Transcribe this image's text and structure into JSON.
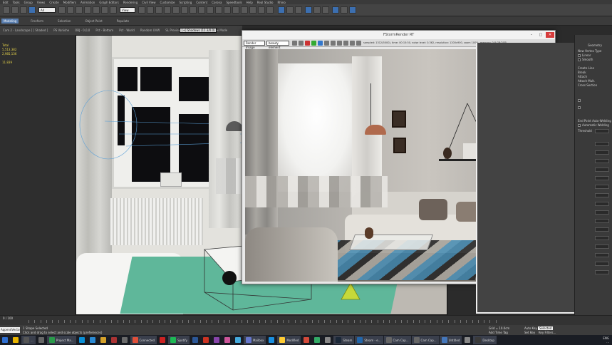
{
  "menu": [
    "Edit",
    "Tools",
    "Group",
    "Views",
    "Create",
    "Modifiers",
    "Animation",
    "Graph Editors",
    "Rendering",
    "Civil View",
    "Customize",
    "Scripting",
    "Content",
    "Corona",
    "Speedtools",
    "Help",
    "Real Studio",
    "Rhino"
  ],
  "toolbar": {
    "filter": "All",
    "view": "View"
  },
  "ribbon": {
    "tabs": [
      "Modeling",
      "Freeform",
      "Selection",
      "Object Paint",
      "Populate"
    ],
    "sub": [
      "Polygon Modeling"
    ],
    "tools": [
      "Cam 2 - Landscape ] [ Shaded ]",
      "PS Vanishe",
      "OBJ - 0,0,0",
      "Pct - Bottom",
      "Pct - World",
      "Random UVW",
      "SL Preview",
      "Glass",
      "Paste",
      "Box Mode"
    ],
    "viewport_select": "[+] Shadows (11.3/0.0)"
  },
  "stats": {
    "title": "Total",
    "polys": "5,513,382",
    "verts": "2,985,136",
    "fps": "11.839"
  },
  "viewport": {
    "label": "[+] [Cam 2 - Landscape] [Shaded]"
  },
  "render_window": {
    "title": "FStormRender RT",
    "channel": "Render Image",
    "element": "beauty element",
    "status": "sampled: 1312(5000), time: 00:15:50, noise level: 0.362, resolution: 1200x900, zoom 100%, memory: 0.8 GB/2GB",
    "colors": {
      "wall": "#cbc7c0",
      "rug_blue": "#3f7fa3",
      "lamp": "#b56b4c"
    }
  },
  "command_panel": {
    "title": "Geometry",
    "items": [
      "New Vertex Type",
      "Linear",
      "Bezier",
      "Smooth",
      "Bezier Corner",
      "Create Line",
      "Break",
      "Attach",
      "Reorient",
      "Attach Mult.",
      "Cross Section",
      "Refine",
      "Connect",
      "Linear",
      "Closed",
      "Bind first",
      "Bind last",
      "Weld",
      "Fuse",
      "Fillet",
      "Chamfer",
      "Outline",
      "Boolean",
      "Mirror",
      "Trim",
      "Extend",
      "Infinite Bounds",
      "Hide",
      "Unhide All",
      "Bind",
      "Unbind",
      "Delete",
      "Close",
      "Divide",
      "Detach",
      "Same Shp",
      "Reorient",
      "Copy",
      "Explode",
      "to Splines",
      "to Objects"
    ],
    "auto_welding": "End Point Auto-Welding",
    "auto_weld": "Automatic Welding",
    "threshold_label": "Threshold"
  },
  "timeline": {
    "frames": "0 / 100"
  },
  "status": {
    "input": "AppendVector",
    "line1": "1 Shape Selected",
    "line2": "Click and drag to select and scale objects (preferences)",
    "grid": "Grid = 10.0cm",
    "add_time_tag": "Add Time Tag",
    "autokey": "Auto Key",
    "selected": "Selected",
    "set_key": "Set Key",
    "key_filters": "Key Filters..."
  },
  "taskbar": [
    {
      "label": "",
      "color": "#2f6fd1"
    },
    {
      "label": "",
      "color": "#e8b400"
    },
    {
      "label": "...",
      "color": "#555"
    },
    {
      "label": "",
      "color": "#666"
    },
    {
      "label": "Project Ma...",
      "color": "#2a9a4a"
    },
    {
      "label": "",
      "color": "#0a8fd6"
    },
    {
      "label": "",
      "color": "#2a8ad4"
    },
    {
      "label": "",
      "color": "#d4a12a"
    },
    {
      "label": "",
      "color": "#aa3333"
    },
    {
      "label": "",
      "color": "#6a6a6a"
    },
    {
      "label": "Connected",
      "color": "#e0503a"
    },
    {
      "label": "",
      "color": "#cc2222"
    },
    {
      "label": "Spotify",
      "color": "#1db954"
    },
    {
      "label": "",
      "color": "#2b5797"
    },
    {
      "label": "",
      "color": "#cc3322"
    },
    {
      "label": "",
      "color": "#8844aa"
    },
    {
      "label": "",
      "color": "#cc5599"
    },
    {
      "label": "",
      "color": "#44aadd"
    },
    {
      "label": "Mailbox",
      "color": "#6677cc"
    },
    {
      "label": "",
      "color": "#1a8fe0"
    },
    {
      "label": "Modified",
      "color": "#ffcc33"
    },
    {
      "label": "",
      "color": "#d44a3a"
    },
    {
      "label": "",
      "color": "#33aa66"
    },
    {
      "label": "",
      "color": "#888"
    },
    {
      "label": "Steam",
      "color": "#1b2838"
    },
    {
      "label": "Steam - e...",
      "color": "#2266aa"
    },
    {
      "label": "Cam Cap...",
      "color": "#666"
    },
    {
      "label": "Cam Cap...",
      "color": "#666"
    },
    {
      "label": "Untitled",
      "color": "#4477bb"
    },
    {
      "label": "",
      "color": "#888"
    },
    {
      "label": "Desktop",
      "color": "#3a3a3a"
    }
  ],
  "clock": {
    "lang": "ENG",
    "time": "..."
  }
}
